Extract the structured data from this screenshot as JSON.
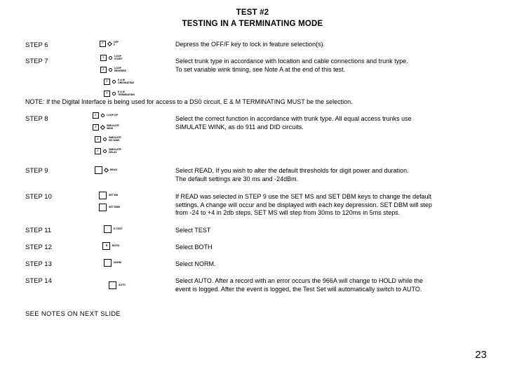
{
  "title": {
    "line1": "TEST #2",
    "line2": "TESTING IN A TERMINATING MODE"
  },
  "steps": [
    {
      "label": "STEP 6",
      "description": "Depress the OFF/F key to lock in feature selection(s).",
      "keys": [
        {
          "cap": "F",
          "led": "diamond",
          "text": "OFF\nF"
        }
      ]
    },
    {
      "label": "STEP 7",
      "description": "Select trunk type in accordance with location and cable connections and trunk type.\nTo set variable wink timing, see Note A at the end of this test.",
      "keys": [
        {
          "cap": "1",
          "led": "round",
          "text": "LOOP\nSTART"
        },
        {
          "cap": "2",
          "led": "round",
          "text": "LOOP\nREVERSE"
        },
        {
          "cap": "3",
          "led": "round",
          "text": "E & M\nORIGINATING"
        },
        {
          "cap": "4",
          "led": "round",
          "text": "E & M\nTERMINATING"
        }
      ]
    },
    {
      "label": "STEP 8",
      "description": "Select the correct function in accordance with trunk type.  All equal access trunks use\nSIMULATE WINK, as do 911 and DID circuits.",
      "keys": [
        {
          "cap": "1",
          "led": "round",
          "text": "LOOP OP"
        },
        {
          "cap": "4",
          "led": "diamond",
          "text": "SIMULATE\nWINK"
        },
        {
          "cap": "3",
          "led": "round",
          "text": "SIMULATE\nNO WINK"
        },
        {
          "cap": "2",
          "led": "round",
          "text": "SIMULATE\nDELAY"
        }
      ]
    },
    {
      "label": "STEP 9",
      "description": "Select READ, If you wish to alter the default thresholds for digit power and duration.\nThe default settings are 30 ms and -24dBm.",
      "keys": [
        {
          "cap": "",
          "led": "diamond",
          "text": "READ"
        }
      ]
    },
    {
      "label": "STEP 10",
      "description": "If READ was selected in STEP 9 use the SET MS and SET DBM keys to change the default\nsettings.  A change will occur and be displayed with each key depression.  SET DBM will step\nfrom -24 to +4 in 2db steps.  SET MS will step from 30ms to 120ms in 5ms steps.",
      "keys": [
        {
          "cap": "",
          "led": "none",
          "text": "SET MS"
        },
        {
          "cap": "",
          "led": "none",
          "text": "SET DBM"
        }
      ]
    },
    {
      "label": "STEP 11",
      "description": "Select TEST",
      "keys": [
        {
          "cap": "",
          "led": "none",
          "text": "D TEST"
        }
      ]
    },
    {
      "label": "STEP 12",
      "description": "Select BOTH",
      "keys": [
        {
          "cap": "II",
          "led": "none",
          "text": "BOTH"
        }
      ]
    },
    {
      "label": "STEP 13",
      "description": "Select NORM.",
      "keys": [
        {
          "cap": "",
          "led": "none",
          "text": "NORM"
        }
      ]
    },
    {
      "label": "STEP 14",
      "description": "Select AUTO.  After a record with an error occurs the 966A will change to HOLD while the\nevent is logged.  After the event is logged, the Test Set will automatically switch to AUTO.",
      "keys": [
        {
          "cap": "",
          "led": "none",
          "text": "AUTO"
        }
      ]
    }
  ],
  "note": "NOTE:  If the Digital Interface is being used for access to a DS0 circuit, E & M TERMINATING MUST be the selection.",
  "footer": "SEE NOTES ON NEXT SLIDE",
  "page_number": "23"
}
